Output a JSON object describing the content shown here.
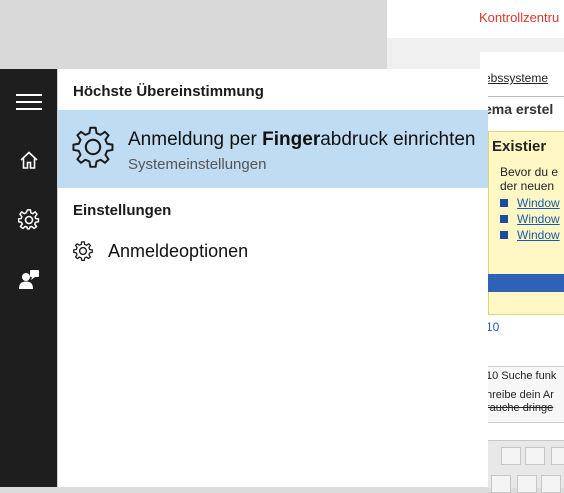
{
  "background_page": {
    "header_link": "Kontrollzentru",
    "breadcrumb": "ebssysteme",
    "heading": "ema erstel",
    "info_box": {
      "title": "Existier",
      "text_line1": "Bevor du e",
      "text_line2": "der neuen",
      "links": [
        "Window",
        "Window",
        "Window"
      ]
    },
    "number_text": "10",
    "search_label": "10 Suche funk",
    "desc_line1": "hreibe dein Ar",
    "desc_line2": "rauche dringe"
  },
  "search_panel": {
    "best_match_header": "Höchste Übereinstimmung",
    "best_match": {
      "title_pre": "Anmeldung per ",
      "title_bold": "Finger",
      "title_post": "abdruck einrichten",
      "subtitle": "Systemeinstellungen",
      "icon": "gear-icon"
    },
    "settings_header": "Einstellungen",
    "settings_items": [
      {
        "label": "Anmeldeoptionen",
        "icon": "gear-icon"
      }
    ]
  },
  "nav_rail": {
    "items": [
      {
        "icon": "hamburger-menu-icon"
      },
      {
        "icon": "home-icon"
      },
      {
        "icon": "settings-icon"
      },
      {
        "icon": "feedback-person-icon"
      }
    ]
  },
  "colors": {
    "rail_bg": "#1e1e1e",
    "highlight_bg": "#bfdcf3",
    "accent_link": "#d9382c"
  }
}
